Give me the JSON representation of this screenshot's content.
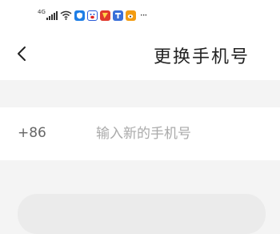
{
  "status_bar": {
    "network_label": "4G",
    "icons": [
      "signal-icon",
      "wifi-icon",
      "shield-app-icon",
      "baidu-app-icon",
      "red-app-icon",
      "tieba-app-icon",
      "weibo-app-icon",
      "more-icon"
    ],
    "more_label": "···"
  },
  "header": {
    "title": "更换手机号"
  },
  "phone": {
    "country_code": "+86",
    "placeholder": "输入新的手机号",
    "value": ""
  },
  "colors": {
    "background": "#f4f4f4",
    "surface": "#ffffff",
    "title_text": "#222222",
    "secondary_text": "#666666",
    "placeholder_text": "#aaaaaa",
    "disabled_button": "#ebebeb"
  }
}
